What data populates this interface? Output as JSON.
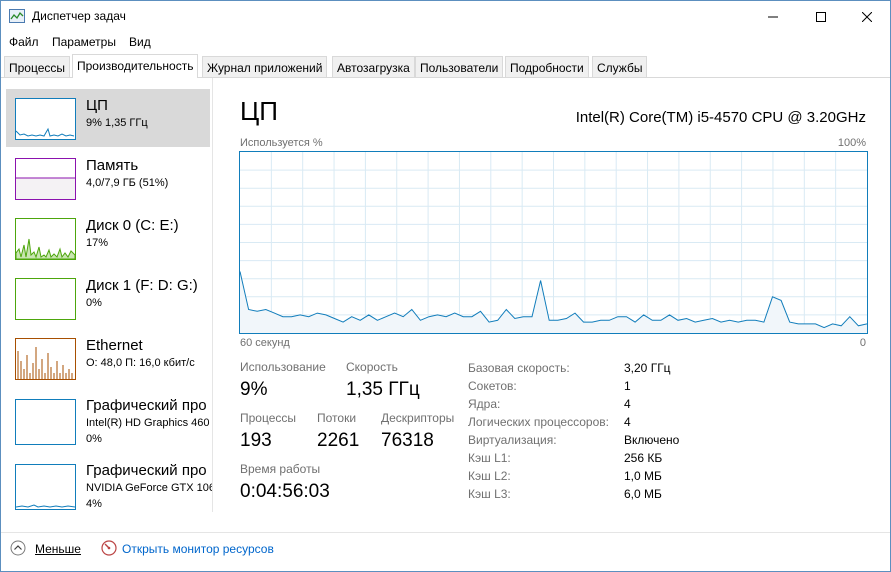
{
  "window": {
    "title": "Диспетчер задач"
  },
  "menu": {
    "file": "Файл",
    "params": "Параметры",
    "view": "Вид"
  },
  "tabs": [
    {
      "label": "Процессы"
    },
    {
      "label": "Производительность"
    },
    {
      "label": "Журнал приложений"
    },
    {
      "label": "Автозагрузка"
    },
    {
      "label": "Пользователи"
    },
    {
      "label": "Подробности"
    },
    {
      "label": "Службы"
    }
  ],
  "resources": [
    {
      "name": "ЦП",
      "sub": "9%  1,35 ГГц",
      "sub2": "",
      "color": "#117dbb"
    },
    {
      "name": "Память",
      "sub": "4,0/7,9 ГБ (51%)",
      "sub2": "",
      "color": "#8b12ae"
    },
    {
      "name": "Диск 0 (C: E:)",
      "sub": "17%",
      "sub2": "",
      "color": "#4da60c"
    },
    {
      "name": "Диск 1 (F: D: G:)",
      "sub": "0%",
      "sub2": "",
      "color": "#4da60c"
    },
    {
      "name": "Ethernet",
      "sub": "О: 48,0  П: 16,0 кбит/с",
      "sub2": "",
      "color": "#a74f01"
    },
    {
      "name": "Графический про",
      "sub": "Intel(R) HD Graphics 460",
      "sub2": "0%",
      "color": "#117dbb"
    },
    {
      "name": "Графический про",
      "sub": "NVIDIA GeForce GTX 106",
      "sub2": "4%",
      "color": "#117dbb"
    }
  ],
  "main": {
    "title": "ЦП",
    "cpu_model": "Intel(R) Core(TM) i5-4570 CPU @ 3.20GHz",
    "graph_label_top": "Используется %",
    "graph_label_max": "100%",
    "graph_label_time": "60 секунд",
    "graph_label_min": "0"
  },
  "chart_data": {
    "type": "area",
    "color": "#117dbb",
    "ylim": [
      0,
      100
    ],
    "x_range_seconds": [
      60,
      0
    ],
    "values": [
      34,
      13,
      12,
      13,
      11,
      9,
      9,
      10,
      9,
      11,
      10,
      8,
      6,
      9,
      7,
      10,
      7,
      9,
      11,
      9,
      13,
      7,
      9,
      10,
      9,
      11,
      9,
      9,
      12,
      6,
      7,
      13,
      8,
      9,
      9,
      29,
      7,
      7,
      8,
      11,
      6,
      6,
      7,
      7,
      9,
      9,
      6,
      10,
      7,
      7,
      10,
      7,
      8,
      6,
      7,
      8,
      6,
      7,
      6,
      7,
      7,
      6,
      20,
      18,
      6,
      5,
      5,
      5,
      3,
      5,
      4,
      9,
      4,
      5
    ]
  },
  "stats": {
    "usage_label": "Использование",
    "usage_value": "9%",
    "speed_label": "Скорость",
    "speed_value": "1,35 ГГц",
    "processes_label": "Процессы",
    "processes_value": "193",
    "threads_label": "Потоки",
    "threads_value": "2261",
    "handles_label": "Дескрипторы",
    "handles_value": "76318",
    "uptime_label": "Время работы",
    "uptime_value": "0:04:56:03"
  },
  "properties": [
    {
      "label": "Базовая скорость:",
      "value": "3,20 ГГц"
    },
    {
      "label": "Сокетов:",
      "value": "1"
    },
    {
      "label": "Ядра:",
      "value": "4"
    },
    {
      "label": "Логических процессоров:",
      "value": "4"
    },
    {
      "label": "Виртуализация:",
      "value": "Включено"
    },
    {
      "label": "Кэш L1:",
      "value": "256 КБ"
    },
    {
      "label": "Кэш L2:",
      "value": "1,0 МБ"
    },
    {
      "label": "Кэш L3:",
      "value": "6,0 МБ"
    }
  ],
  "footer": {
    "fewer_label": "Меньше",
    "monitor_link": "Открыть монитор ресурсов"
  }
}
